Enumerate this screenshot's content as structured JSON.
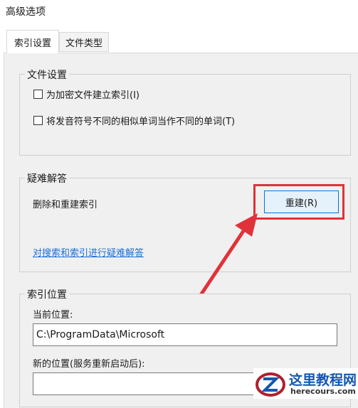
{
  "dialog": {
    "title": "高级选项"
  },
  "tabs": [
    {
      "label": "索引设置",
      "active": true
    },
    {
      "label": "文件类型",
      "active": false
    }
  ],
  "file_settings": {
    "title": "文件设置",
    "encrypt_label": "为加密文件建立索引(I)",
    "diacritics_label": "将发音符号不同的相似单词当作不同的单词(T)"
  },
  "troubleshoot": {
    "title": "疑难解答",
    "rebuild_text": "删除和重建索引",
    "rebuild_button": "重建(R)",
    "link": "对搜索和索引进行疑难解答"
  },
  "index_location": {
    "title": "索引位置",
    "current_label": "当前位置:",
    "current_value": "C:\\ProgramData\\Microsoft",
    "new_label": "新的位置(服务重新启动后):",
    "new_value": ""
  },
  "watermark": {
    "name": "这里教程网",
    "url": "herecours.com"
  },
  "colors": {
    "highlight": "#e0323a",
    "link": "#1d6fd6",
    "button_border": "#0078d7"
  }
}
